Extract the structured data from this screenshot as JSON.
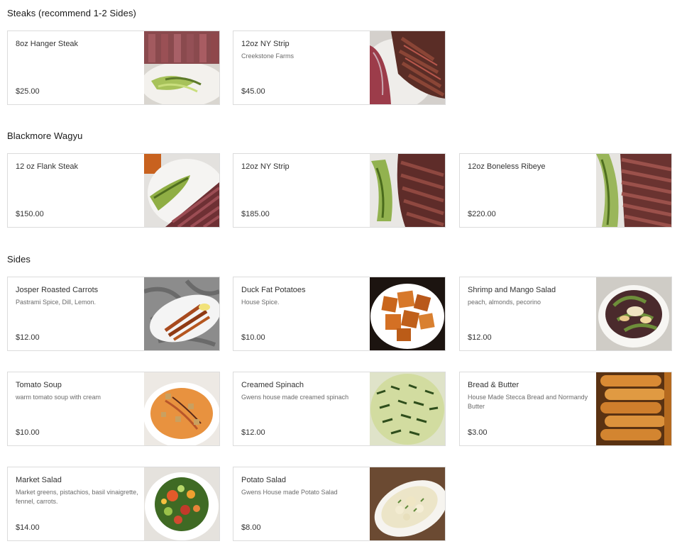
{
  "sections": [
    {
      "title": "Steaks (recommend 1-2 Sides)",
      "items": [
        {
          "name": "8oz Hanger Steak",
          "desc": "",
          "price": "$25.00",
          "img": "steak-plate-image"
        },
        {
          "name": "12oz NY Strip",
          "desc": "Creekstone Farms",
          "price": "$45.00",
          "img": "sliced-steak-image"
        }
      ]
    },
    {
      "title": "Blackmore Wagyu",
      "items": [
        {
          "name": "12 oz Flank Steak",
          "desc": "",
          "price": "$150.00",
          "img": "flank-steak-image"
        },
        {
          "name": "12oz NY Strip",
          "desc": "",
          "price": "$185.00",
          "img": "wagyu-strip-image"
        },
        {
          "name": "12oz Boneless Ribeye",
          "desc": "",
          "price": "$220.00",
          "img": "ribeye-image"
        }
      ]
    },
    {
      "title": "Sides",
      "items": [
        {
          "name": "Josper Roasted Carrots",
          "desc": "Pastrami Spice, Dill, Lemon.",
          "price": "$12.00",
          "img": "carrots-image"
        },
        {
          "name": "Duck Fat Potatoes",
          "desc": "House Spice.",
          "price": "$10.00",
          "img": "potatoes-image"
        },
        {
          "name": "Shrimp and Mango Salad",
          "desc": "peach, almonds, pecorino",
          "price": "$12.00",
          "img": "shrimp-salad-image"
        },
        {
          "name": "Tomato Soup",
          "desc": "warm tomato soup with cream",
          "price": "$10.00",
          "img": "tomato-soup-image"
        },
        {
          "name": "Creamed Spinach",
          "desc": "Gwens house made creamed spinach",
          "price": "$12.00",
          "img": "creamed-spinach-image"
        },
        {
          "name": "Bread & Butter",
          "desc": "House Made Stecca Bread and Normandy Butter",
          "price": "$3.00",
          "img": "bread-image"
        },
        {
          "name": "Market Salad",
          "desc": "Market greens, pistachios, basil vinaigrette, fennel, carrots.",
          "price": "$14.00",
          "img": "market-salad-image"
        },
        {
          "name": "Potato Salad",
          "desc": "Gwens House made Potato Salad",
          "price": "$8.00",
          "img": "potato-salad-image"
        }
      ]
    }
  ]
}
